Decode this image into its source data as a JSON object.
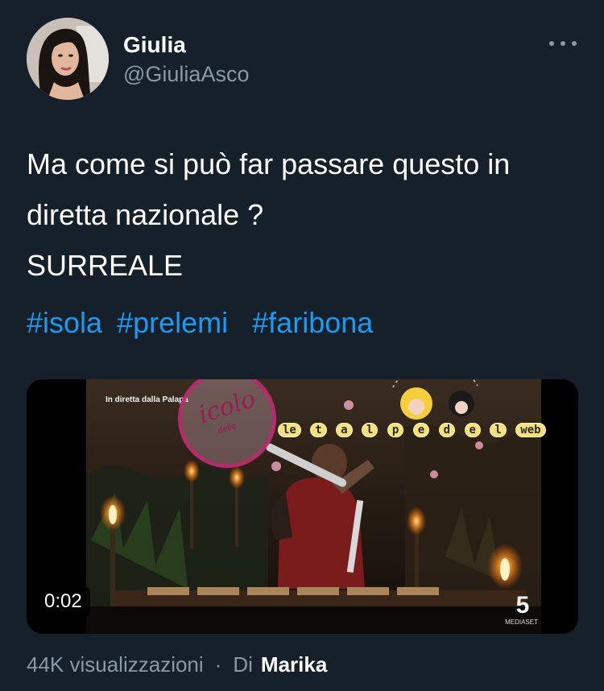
{
  "author": {
    "display_name": "Giulia",
    "handle": "@GiuliaAsco",
    "avatar_icon": "profile-photo"
  },
  "tweet": {
    "lines": [
      "Ma come si può far passare questo in",
      "diretta nazionale ?",
      "SURREALE"
    ],
    "hashtags": [
      "#isola",
      "#prelemi",
      "#faribona"
    ],
    "hashtag_color": "#1d9bf0"
  },
  "video": {
    "timestamp": "0:02",
    "overlay_caption": "In diretta dalla Palapa",
    "watermark_1_main": "icolo",
    "watermark_1_small": "delle",
    "watermark_2_letters": [
      "le",
      "t",
      "a",
      "l",
      "p",
      "e",
      "d",
      "e",
      "l",
      "web"
    ],
    "channel_logo": "5",
    "channel_sub": "MEDIASET"
  },
  "footer": {
    "views": "44K visualizzazioni",
    "separator": "·",
    "by_label": "Di",
    "by_name": "Marika"
  },
  "colors": {
    "background": "#15202b",
    "secondary_text": "#8b98a5",
    "link": "#1d9bf0"
  }
}
